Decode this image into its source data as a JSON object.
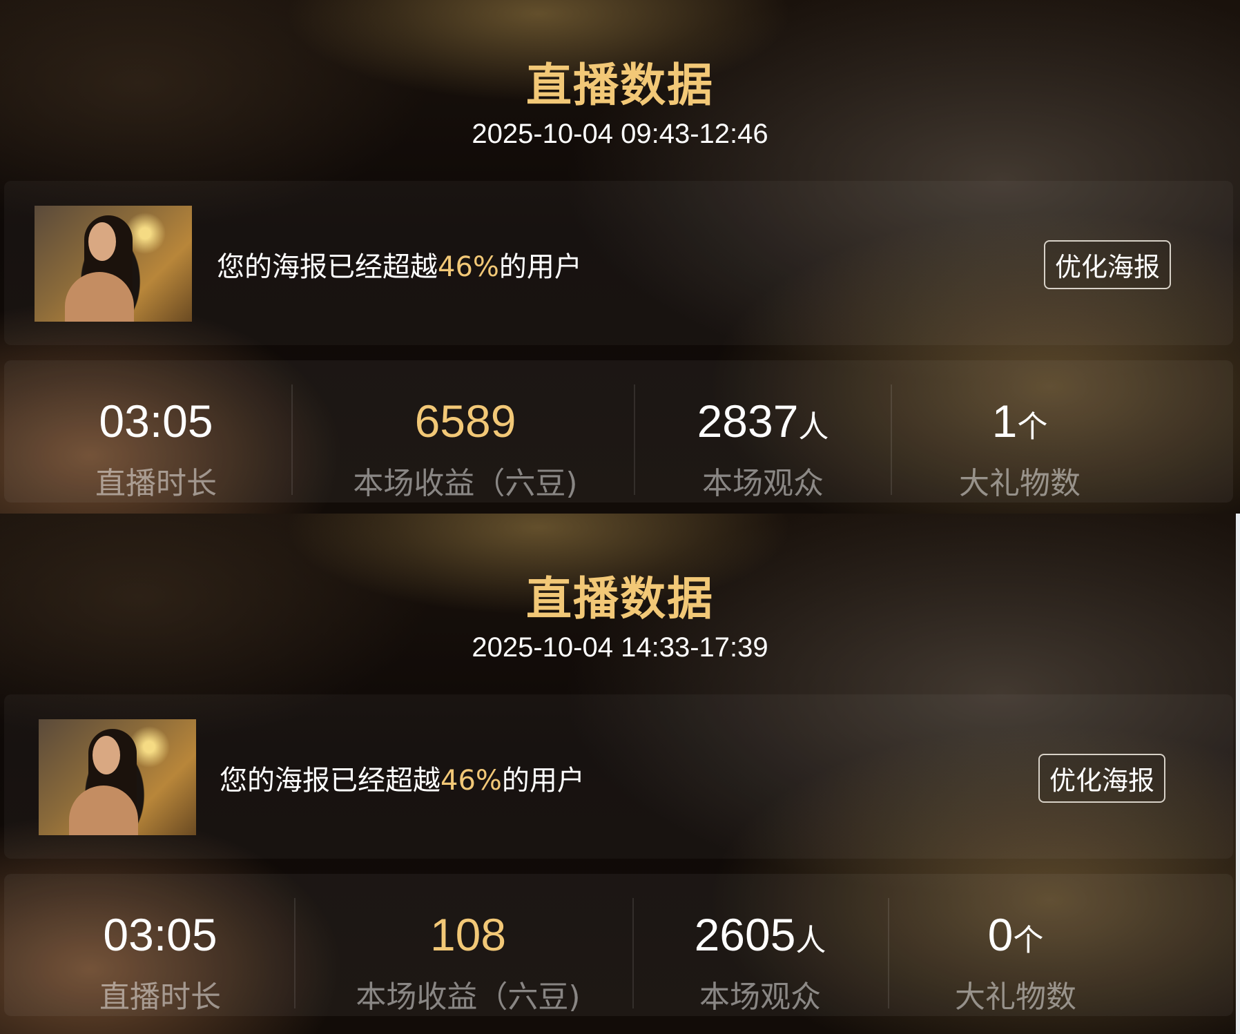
{
  "sessions": [
    {
      "title": "直播数据",
      "time_range": "2025-10-04 09:43-12:46",
      "poster": {
        "text_prefix": "您的海报已经超越",
        "percent": "46%",
        "text_suffix": "的用户",
        "button_label": "优化海报"
      },
      "stats": {
        "duration": {
          "value": "03:05",
          "unit": "",
          "label": "直播时长"
        },
        "revenue": {
          "value": "6589",
          "unit": "",
          "label": "本场收益（六豆)"
        },
        "audience": {
          "value": "2837",
          "unit": "人",
          "label": "本场观众"
        },
        "gifts": {
          "value": "1",
          "unit": "个",
          "label": "大礼物数"
        }
      }
    },
    {
      "title": "直播数据",
      "time_range": "2025-10-04 14:33-17:39",
      "poster": {
        "text_prefix": "您的海报已经超越",
        "percent": "46%",
        "text_suffix": "的用户",
        "button_label": "优化海报"
      },
      "stats": {
        "duration": {
          "value": "03:05",
          "unit": "",
          "label": "直播时长"
        },
        "revenue": {
          "value": "108",
          "unit": "",
          "label": "本场收益（六豆)"
        },
        "audience": {
          "value": "2605",
          "unit": "人",
          "label": "本场观众"
        },
        "gifts": {
          "value": "0",
          "unit": "个",
          "label": "大礼物数"
        }
      }
    }
  ],
  "colors": {
    "accent_gold": "#f2c877",
    "text_primary": "#ffffff",
    "text_secondary": "rgba(255,255,255,0.48)"
  }
}
